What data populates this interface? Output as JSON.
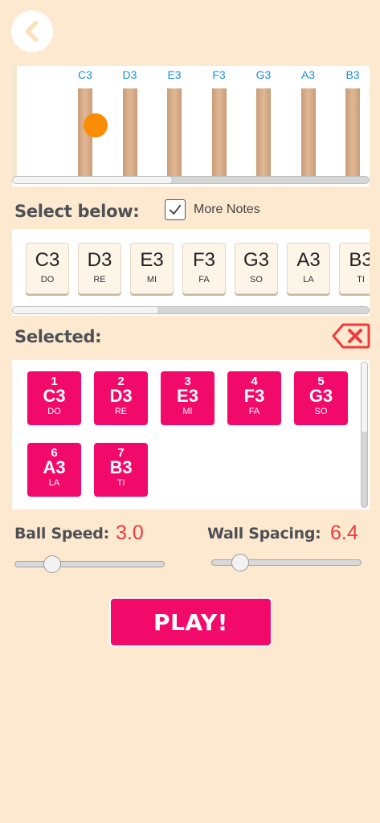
{
  "back_icon": "chevron-left-icon",
  "preview": {
    "walls": [
      "C3",
      "D3",
      "E3",
      "F3",
      "G3",
      "A3",
      "B3"
    ],
    "scroll_fraction": 0.45
  },
  "select_below_title": "Select below:",
  "more_notes": {
    "label": "More Notes",
    "checked": true
  },
  "palette": {
    "notes": [
      {
        "note": "C3",
        "solfege": "DO"
      },
      {
        "note": "D3",
        "solfege": "RE"
      },
      {
        "note": "E3",
        "solfege": "MI"
      },
      {
        "note": "F3",
        "solfege": "FA"
      },
      {
        "note": "G3",
        "solfege": "SO"
      },
      {
        "note": "A3",
        "solfege": "LA"
      },
      {
        "note": "B3",
        "solfege": "TI"
      }
    ],
    "scroll_fraction": 0.41
  },
  "selected_title": "Selected:",
  "delete_icon": "backspace-x-icon",
  "selected": [
    {
      "index": "1",
      "note": "C3",
      "solfege": "DO"
    },
    {
      "index": "2",
      "note": "D3",
      "solfege": "RE"
    },
    {
      "index": "3",
      "note": "E3",
      "solfege": "MI"
    },
    {
      "index": "4",
      "note": "F3",
      "solfege": "FA"
    },
    {
      "index": "5",
      "note": "G3",
      "solfege": "SO"
    },
    {
      "index": "6",
      "note": "A3",
      "solfege": "LA"
    },
    {
      "index": "7",
      "note": "B3",
      "solfege": "TI"
    }
  ],
  "ball_speed": {
    "label": "Ball Speed:",
    "value": "3.0",
    "slider_fraction": 0.25
  },
  "wall_spacing": {
    "label": "Wall Spacing:",
    "value": "6.4",
    "slider_fraction": 0.19
  },
  "play_label": "PLAY!",
  "colors": {
    "accent": "#f20a6b",
    "background": "#fde9cf",
    "value_red": "#f0393c",
    "note_blue": "#1a8fd8",
    "ball_orange": "#fb8c06"
  }
}
